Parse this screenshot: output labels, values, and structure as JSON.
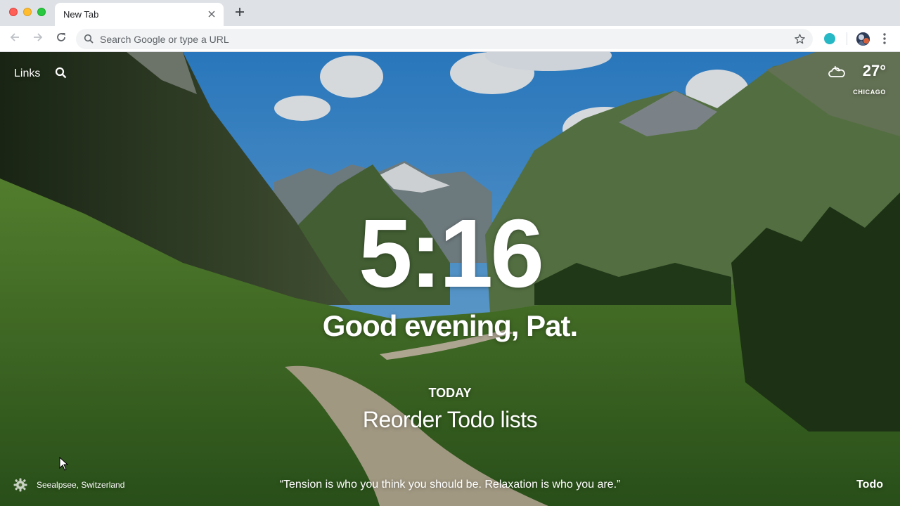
{
  "browser": {
    "tab_title": "New Tab",
    "omnibox_placeholder": "Search Google or type a URL",
    "icons": [
      "back-arrow-icon",
      "forward-arrow-icon",
      "reload-icon",
      "search-icon",
      "star-icon",
      "extension-icon",
      "avatar",
      "kebab-menu-icon",
      "close-icon",
      "plus-icon"
    ]
  },
  "dashboard": {
    "links_label": "Links",
    "weather": {
      "temperature": "27°",
      "city": "CHICAGO",
      "icon": "partly-cloudy-night-icon"
    },
    "time": "5:16",
    "greeting": "Good evening, Pat.",
    "focus": {
      "label": "TODAY",
      "text": "Reorder Todo lists"
    },
    "photo_location": "Seealpsee, Switzerland",
    "quote": "“Tension is who you think you should be. Relaxation is who you are.”",
    "todo_label": "Todo"
  },
  "colors": {
    "accent_extension": "#27b8c5",
    "text_on_photo": "#ffffff"
  }
}
